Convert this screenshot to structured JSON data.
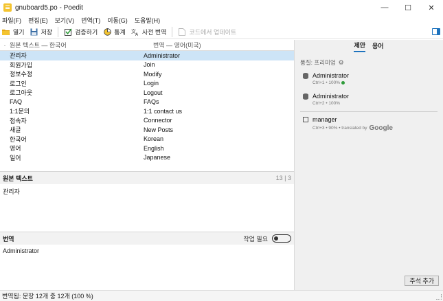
{
  "window": {
    "title": "gnuboard5.po - Poedit",
    "minimize": "—",
    "maximize": "☐",
    "close": "✕"
  },
  "menu": [
    "파일(F)",
    "편집(E)",
    "보기(V)",
    "번역(T)",
    "이동(G)",
    "도움말(H)"
  ],
  "toolbar": {
    "open": "열기",
    "save": "저장",
    "validate": "검증하기",
    "stats": "통계",
    "pretranslate": "사전 번역",
    "update": "코드에서 업데이트"
  },
  "list": {
    "col_source": "원본 텍스트 — 한국어",
    "col_translation": "번역 — 영어(미국)",
    "rows": [
      {
        "src": "관리자",
        "tr": "Administrator"
      },
      {
        "src": "회원가입",
        "tr": "Join"
      },
      {
        "src": "정보수정",
        "tr": "Modify"
      },
      {
        "src": "로그인",
        "tr": "Login"
      },
      {
        "src": "로그아웃",
        "tr": "Logout"
      },
      {
        "src": "FAQ",
        "tr": "FAQs"
      },
      {
        "src": "1:1문의",
        "tr": "1:1 contact us"
      },
      {
        "src": "접속자",
        "tr": "Connector"
      },
      {
        "src": "새글",
        "tr": "New Posts"
      },
      {
        "src": "한국어",
        "tr": "Korean"
      },
      {
        "src": "영어",
        "tr": "English"
      },
      {
        "src": "일어",
        "tr": "Japanese"
      }
    ]
  },
  "source_panel": {
    "label": "원본 텍스트",
    "count": "13 | 3",
    "text": "관리자"
  },
  "translation_panel": {
    "label": "번역",
    "needs_work": "작업 필요",
    "text": "Administrator"
  },
  "sidebar": {
    "tab_suggestions": "제안",
    "tab_terms": "용어",
    "quality": "품질: 프리미엄",
    "suggestions": [
      {
        "text": "Administrator",
        "meta": "Ctrl+1 • 100%"
      },
      {
        "text": "Administrator",
        "meta": "Ctrl+2 • 100%"
      },
      {
        "text": "manager",
        "meta": "Ctrl+3 • 90% • translated by",
        "provider": "Google"
      }
    ],
    "add_comment": "주석 추가"
  },
  "status": {
    "text": "번역됨: 문장 12개 중 12개 (100 %)"
  },
  "colors": {
    "accent": "#1e73be",
    "selection": "#cde4f7",
    "ok": "#2e9b3a"
  }
}
